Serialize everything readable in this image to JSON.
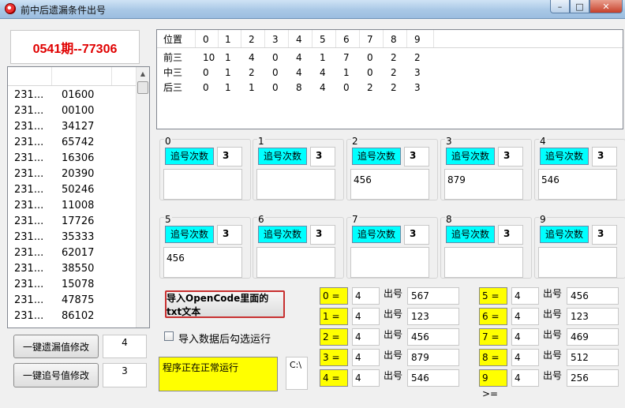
{
  "window": {
    "title": "前中后遗漏条件出号",
    "min_glyph": "–",
    "max_glyph": "□",
    "close_glyph": "✕"
  },
  "headline": "0541期--77306",
  "history": {
    "rows": [
      {
        "id": "231...",
        "num": "01600"
      },
      {
        "id": "231...",
        "num": "00100"
      },
      {
        "id": "231...",
        "num": "34127"
      },
      {
        "id": "231...",
        "num": "65742"
      },
      {
        "id": "231...",
        "num": "16306"
      },
      {
        "id": "231...",
        "num": "20390"
      },
      {
        "id": "231...",
        "num": "50246"
      },
      {
        "id": "231...",
        "num": "11008"
      },
      {
        "id": "231...",
        "num": "17726"
      },
      {
        "id": "231...",
        "num": "35333"
      },
      {
        "id": "231...",
        "num": "62017"
      },
      {
        "id": "231...",
        "num": "38550"
      },
      {
        "id": "231...",
        "num": "15078"
      },
      {
        "id": "231...",
        "num": "47875"
      },
      {
        "id": "231...",
        "num": "86102"
      }
    ]
  },
  "buttons": {
    "omission_modify": "一键遗漏值修改",
    "chase_modify": "一键追号值修改",
    "import_txt": "导入OpenCode里面的txt文本"
  },
  "omission_value": "4",
  "chase_value": "3",
  "position_table": {
    "header": [
      "位置",
      "0",
      "1",
      "2",
      "3",
      "4",
      "5",
      "6",
      "7",
      "8",
      "9"
    ],
    "rows": [
      [
        "前三",
        "10",
        "1",
        "4",
        "0",
        "4",
        "1",
        "7",
        "0",
        "2",
        "2"
      ],
      [
        "中三",
        "0",
        "1",
        "2",
        "0",
        "4",
        "4",
        "1",
        "0",
        "2",
        "3"
      ],
      [
        "后三",
        "0",
        "1",
        "1",
        "0",
        "8",
        "4",
        "0",
        "2",
        "2",
        "3"
      ]
    ]
  },
  "chase_label": "追号次数",
  "groups": [
    {
      "label": "0",
      "count": "3",
      "result": ""
    },
    {
      "label": "1",
      "count": "3",
      "result": ""
    },
    {
      "label": "2",
      "count": "3",
      "result": "456"
    },
    {
      "label": "3",
      "count": "3",
      "result": "879"
    },
    {
      "label": "4",
      "count": "3",
      "result": "546"
    },
    {
      "label": "5",
      "count": "3",
      "result": "456"
    },
    {
      "label": "6",
      "count": "3",
      "result": ""
    },
    {
      "label": "7",
      "count": "3",
      "result": ""
    },
    {
      "label": "8",
      "count": "3",
      "result": ""
    },
    {
      "label": "9",
      "count": "3",
      "result": ""
    }
  ],
  "auto_run_checkbox": {
    "label": "导入数据后勾选运行",
    "checked": false
  },
  "status_text": "程序正在正常运行",
  "path_text": "C:\\",
  "output_label": "出号",
  "conditions_left": [
    {
      "label": "0 =",
      "value": "4",
      "output": "567"
    },
    {
      "label": "1 =",
      "value": "4",
      "output": "123"
    },
    {
      "label": "2 =",
      "value": "4",
      "output": "456"
    },
    {
      "label": "3 =",
      "value": "4",
      "output": "879"
    },
    {
      "label": "4 =",
      "value": "4",
      "output": "546"
    }
  ],
  "conditions_right": [
    {
      "label": "5 =",
      "value": "4",
      "output": "456"
    },
    {
      "label": "6 =",
      "value": "4",
      "output": "123"
    },
    {
      "label": "7 =",
      "value": "4",
      "output": "469"
    },
    {
      "label": "8 =",
      "value": "4",
      "output": "512"
    },
    {
      "label": "9 >=",
      "value": "4",
      "output": "256"
    }
  ]
}
